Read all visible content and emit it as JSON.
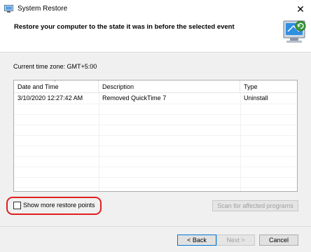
{
  "window": {
    "title": "System Restore",
    "close_glyph": "✕",
    "icons": {
      "app": "system-restore-icon",
      "close": "close-icon"
    }
  },
  "header": {
    "title": "Restore your computer to the state it was in before the selected event",
    "image": "system-restore-computer-icon"
  },
  "timezone": "Current time zone: GMT+5:00",
  "table": {
    "columns": [
      "Date and Time",
      "Description",
      "Type"
    ],
    "sort_indicator": "^",
    "rows": [
      {
        "date": "3/10/2020 12:27:42 AM",
        "description": "Removed QuickTime 7",
        "type": "Uninstall"
      }
    ]
  },
  "checkbox": {
    "label": "Show more restore points",
    "checked": false
  },
  "buttons": {
    "scan": "Scan for affected programs",
    "back": "< Back",
    "next": "Next >",
    "cancel": "Cancel"
  },
  "colors": {
    "highlight": "#e01f1f",
    "focus": "#0078d7"
  }
}
